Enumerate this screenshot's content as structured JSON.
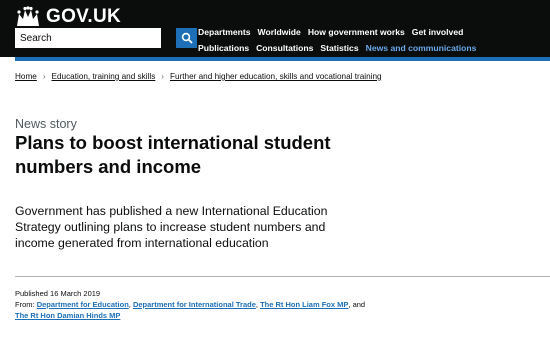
{
  "header": {
    "logo_text": "GOV.UK",
    "search": {
      "placeholder": "Search"
    },
    "nav_row1": [
      "Departments",
      "Worldwide",
      "How government works",
      "Get involved"
    ],
    "nav_row2": [
      "Publications",
      "Consultations",
      "Statistics",
      "News and communications"
    ]
  },
  "breadcrumb": [
    "Home",
    "Education, training and skills",
    "Further and higher education, skills and vocational training"
  ],
  "article": {
    "type": "News story",
    "title": "Plans to boost international student numbers and income",
    "lead": "Government has published a new International Education Strategy outlining plans to increase student numbers and income generated from international education"
  },
  "metadata": {
    "published_label": "Published",
    "published_date": "16 March 2019",
    "from_label": "From:",
    "organisations": [
      "Department for Education",
      "Department for International Trade",
      "The Rt Hon Liam Fox MP",
      "The Rt Hon Damian Hinds MP"
    ],
    "and_word": "and"
  },
  "colors": {
    "brand_blue": "#1d70b8",
    "header_bg": "#0b0c0c",
    "active_nav": "#6aa8e8"
  }
}
